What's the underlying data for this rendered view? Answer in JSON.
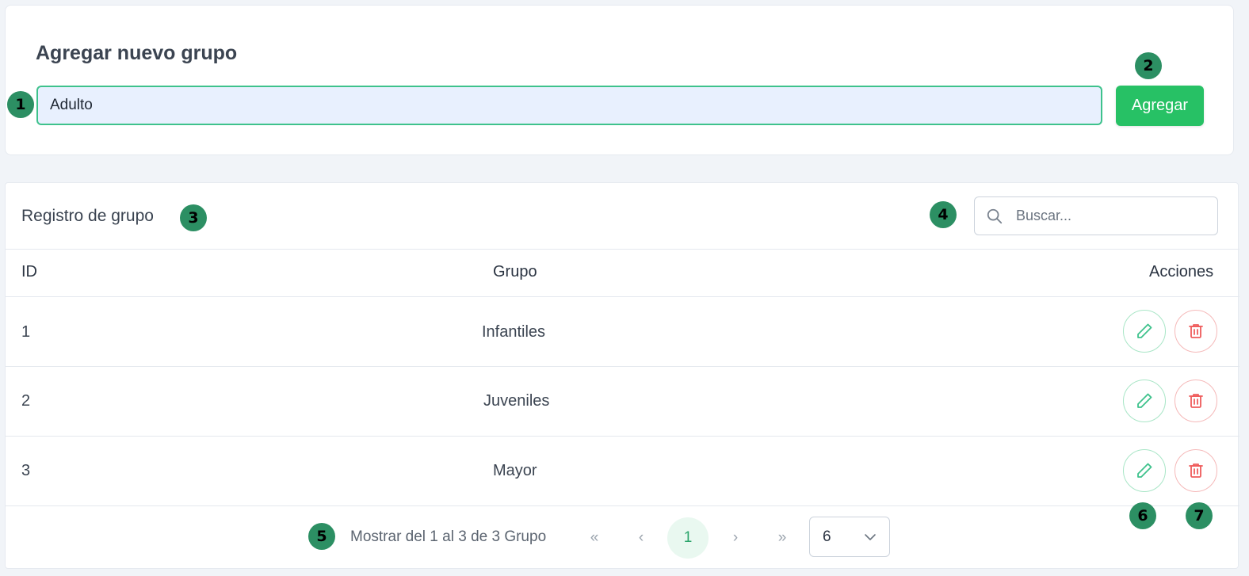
{
  "add_group": {
    "title": "Agregar nuevo grupo",
    "input_value": "Adulto",
    "add_button": "Agregar"
  },
  "registry": {
    "title": "Registro de grupo",
    "search_placeholder": "Buscar...",
    "columns": [
      "ID",
      "Grupo",
      "Acciones"
    ],
    "rows": [
      {
        "id": "1",
        "group": "Infantiles"
      },
      {
        "id": "2",
        "group": "Juveniles"
      },
      {
        "id": "3",
        "group": "Mayor"
      }
    ]
  },
  "pagination": {
    "summary": "Mostrar del 1 al 3 de 3 Grupo",
    "first": "«",
    "prev": "‹",
    "current_page": "1",
    "next": "›",
    "last": "»",
    "per_page": "6"
  },
  "markers": [
    "1",
    "2",
    "3",
    "4",
    "5",
    "6",
    "7"
  ],
  "icons": {
    "search": "search-icon",
    "edit": "pencil-icon",
    "delete": "trash-icon",
    "dropdown": "chevron-down-icon"
  },
  "colors": {
    "primary_green": "#27c165",
    "marker": "#2c8f63",
    "edit_accent": "#3ec28c",
    "delete_accent": "#ef5b5b"
  }
}
